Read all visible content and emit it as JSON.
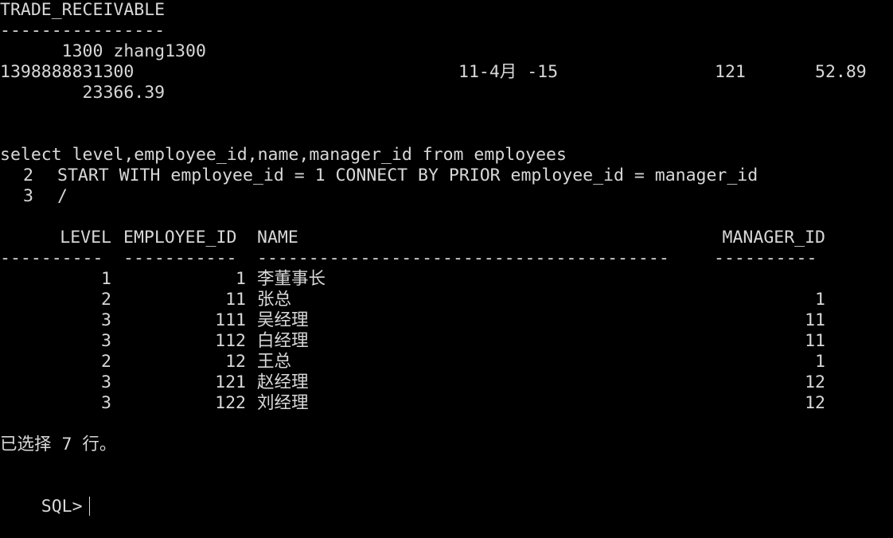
{
  "prev_output": {
    "header": "TRADE_RECEIVABLE",
    "underline": "----------------",
    "row1": "      1300 zhang1300",
    "row2_phone": "1398888831300",
    "row2_date": "11-4月 -15",
    "row2_num1": "121",
    "row2_num2": "52.89",
    "row3": "        23366.39"
  },
  "query": {
    "line1": "select level,employee_id,name,manager_id from employees",
    "line2_no": "2",
    "line2": "START WITH employee_id = 1 CONNECT BY PRIOR employee_id = manager_id",
    "line3_no": "3",
    "line3": "/"
  },
  "result_table": {
    "columns": [
      "LEVEL",
      "EMPLOYEE_ID",
      "NAME",
      "MANAGER_ID"
    ],
    "separators": [
      "----------",
      "-----------",
      "----------------------------------------",
      "----------"
    ],
    "rows": [
      {
        "level": "1",
        "employee_id": "1",
        "name": "李董事长",
        "manager_id": ""
      },
      {
        "level": "2",
        "employee_id": "11",
        "name": "张总",
        "manager_id": "1"
      },
      {
        "level": "3",
        "employee_id": "111",
        "name": "吴经理",
        "manager_id": "11"
      },
      {
        "level": "3",
        "employee_id": "112",
        "name": "白经理",
        "manager_id": "11"
      },
      {
        "level": "2",
        "employee_id": "12",
        "name": "王总",
        "manager_id": "1"
      },
      {
        "level": "3",
        "employee_id": "121",
        "name": "赵经理",
        "manager_id": "12"
      },
      {
        "level": "3",
        "employee_id": "122",
        "name": "刘经理",
        "manager_id": "12"
      }
    ]
  },
  "footer": {
    "rows_selected": "已选择 7 行。",
    "prompt": "SQL>"
  }
}
